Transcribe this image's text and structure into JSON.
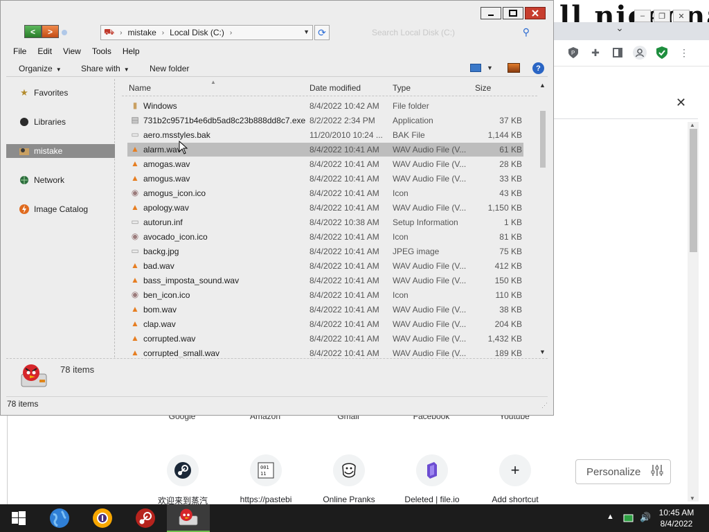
{
  "browser": {
    "logo_text": "ll niceona",
    "window_buttons": [
      "–",
      "❐",
      "✕"
    ],
    "close_infobar": "✕",
    "site_labels": [
      "Google",
      "Amazon",
      "Gmail",
      "Facebook",
      "Youtube"
    ],
    "shortcuts": [
      {
        "label": "欢迎来到蒸汽",
        "icon": "steam-icon"
      },
      {
        "label": "https://pastebi",
        "icon": "binary-icon"
      },
      {
        "label": "Online Pranks",
        "icon": "troll-face-icon"
      },
      {
        "label": "Deleted | file.io",
        "icon": "file-io-icon"
      },
      {
        "label": "Add shortcut",
        "icon": "plus-icon"
      }
    ],
    "personalize_label": "Personalize"
  },
  "explorer": {
    "address": {
      "crumbs": [
        "mistake",
        "Local Disk (C:)"
      ]
    },
    "search_placeholder": "Search Local Disk (C:)",
    "menu": [
      "File",
      "Edit",
      "View",
      "Tools",
      "Help"
    ],
    "commands": {
      "organize": "Organize",
      "share": "Share with",
      "new_folder": "New folder"
    },
    "nav": [
      {
        "label": "Favorites",
        "icon": "star-icon"
      },
      {
        "label": "Libraries",
        "icon": "libraries-icon"
      },
      {
        "label": "mistake",
        "icon": "user-folder-icon",
        "selected": true
      },
      {
        "label": "Network",
        "icon": "network-icon"
      },
      {
        "label": "Image Catalog",
        "icon": "image-catalog-icon"
      }
    ],
    "columns": {
      "name": "Name",
      "date": "Date modified",
      "type": "Type",
      "size": "Size"
    },
    "files": [
      {
        "name": "Windows",
        "date": "8/4/2022 10:42 AM",
        "type": "File folder",
        "size": "",
        "icon": "folder-icon"
      },
      {
        "name": "731b2c9571b4e6db5ad8c23b888dd8c7.exe",
        "date": "8/2/2022 2:34 PM",
        "type": "Application",
        "size": "37 KB",
        "icon": "exe-icon"
      },
      {
        "name": "aero.msstyles.bak",
        "date": "11/20/2010 10:24 ...",
        "type": "BAK File",
        "size": "1,144 KB",
        "icon": "file-icon"
      },
      {
        "name": "alarm.wav",
        "date": "8/4/2022 10:41 AM",
        "type": "WAV Audio File (V...",
        "size": "61 KB",
        "icon": "vlc-icon",
        "selected": true
      },
      {
        "name": "amogas.wav",
        "date": "8/4/2022 10:41 AM",
        "type": "WAV Audio File (V...",
        "size": "28 KB",
        "icon": "vlc-icon"
      },
      {
        "name": "amogus.wav",
        "date": "8/4/2022 10:41 AM",
        "type": "WAV Audio File (V...",
        "size": "33 KB",
        "icon": "vlc-icon"
      },
      {
        "name": "amogus_icon.ico",
        "date": "8/4/2022 10:41 AM",
        "type": "Icon",
        "size": "43 KB",
        "icon": "ico-icon"
      },
      {
        "name": "apology.wav",
        "date": "8/4/2022 10:41 AM",
        "type": "WAV Audio File (V...",
        "size": "1,150 KB",
        "icon": "vlc-icon"
      },
      {
        "name": "autorun.inf",
        "date": "8/4/2022 10:38 AM",
        "type": "Setup Information",
        "size": "1 KB",
        "icon": "file-icon"
      },
      {
        "name": "avocado_icon.ico",
        "date": "8/4/2022 10:41 AM",
        "type": "Icon",
        "size": "81 KB",
        "icon": "ico-icon"
      },
      {
        "name": "backg.jpg",
        "date": "8/4/2022 10:41 AM",
        "type": "JPEG image",
        "size": "75 KB",
        "icon": "image-icon"
      },
      {
        "name": "bad.wav",
        "date": "8/4/2022 10:41 AM",
        "type": "WAV Audio File (V...",
        "size": "412 KB",
        "icon": "vlc-icon"
      },
      {
        "name": "bass_imposta_sound.wav",
        "date": "8/4/2022 10:41 AM",
        "type": "WAV Audio File (V...",
        "size": "150 KB",
        "icon": "vlc-icon"
      },
      {
        "name": "ben_icon.ico",
        "date": "8/4/2022 10:41 AM",
        "type": "Icon",
        "size": "110 KB",
        "icon": "ico-icon"
      },
      {
        "name": "bom.wav",
        "date": "8/4/2022 10:41 AM",
        "type": "WAV Audio File (V...",
        "size": "38 KB",
        "icon": "vlc-icon"
      },
      {
        "name": "clap.wav",
        "date": "8/4/2022 10:41 AM",
        "type": "WAV Audio File (V...",
        "size": "204 KB",
        "icon": "vlc-icon"
      },
      {
        "name": "corrupted.wav",
        "date": "8/4/2022 10:41 AM",
        "type": "WAV Audio File (V...",
        "size": "1,432 KB",
        "icon": "vlc-icon"
      },
      {
        "name": "corrupted_small.wav",
        "date": "8/4/2022 10:41 AM",
        "type": "WAV Audio File (V...",
        "size": "189 KB",
        "icon": "vlc-icon"
      }
    ],
    "details_count": "78 items",
    "status_count": "78 items"
  },
  "taskbar": {
    "time": "10:45 AM",
    "date": "8/4/2022",
    "apps": [
      "start-icon",
      "browser-globe-icon",
      "chrome-app-icon",
      "steam-app-icon",
      "angry-bird-explorer-icon"
    ]
  }
}
